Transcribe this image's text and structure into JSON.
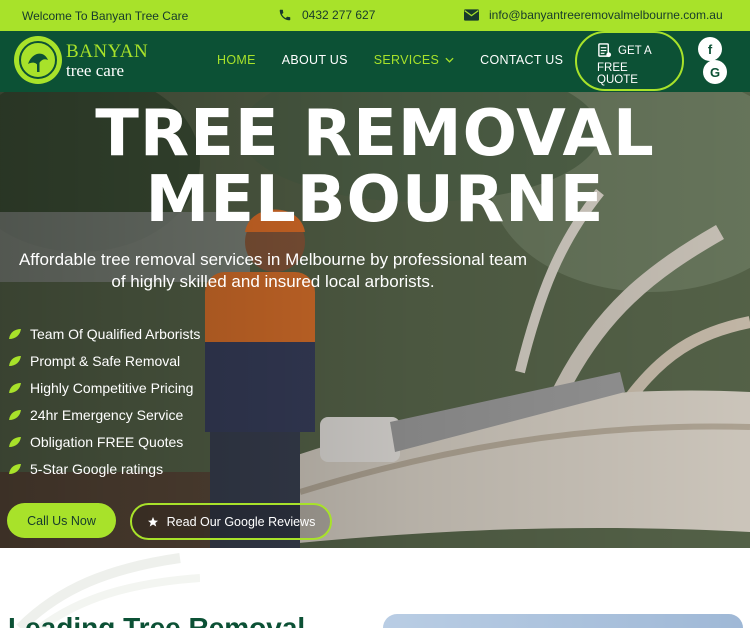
{
  "topbar": {
    "welcome": "Welcome To Banyan Tree Care",
    "phone": "0432 277 627",
    "email": "info@banyantreeremovalmelbourne.com.au"
  },
  "logo": {
    "line1": "BANYAN",
    "line2": "tree care"
  },
  "nav": {
    "home": "HOME",
    "about": "ABOUT US",
    "services": "SERVICES",
    "contact": "CONTACT US"
  },
  "quote": {
    "line1": "GET A",
    "line2": "FREE",
    "line3": "QUOTE"
  },
  "social": {
    "facebook": "f",
    "google": "G"
  },
  "hero": {
    "title_line1": "TREE REMOVAL",
    "title_line2": "MELBOURNE",
    "subtitle": "Affordable tree removal services in Melbourne by professional team of highly skilled and insured local arborists.",
    "features": [
      "Team Of Qualified Arborists",
      "Prompt & Safe Removal",
      "Highly Competitive Pricing",
      "24hr Emergency Service",
      "Obligation FREE Quotes",
      "5-Star Google ratings"
    ],
    "call_button": "Call Us Now",
    "review_button": "Read Our Google Reviews"
  },
  "below": {
    "heading": "Leading Tree Removal"
  },
  "colors": {
    "accent": "#a8e22a",
    "nav_bg": "#0c5135",
    "dark_text": "#163a2c"
  },
  "icons": [
    "phone-icon",
    "mail-icon",
    "chevron-down-icon",
    "quote-icon",
    "leaf-icon",
    "star-icon",
    "facebook-icon",
    "google-icon"
  ]
}
